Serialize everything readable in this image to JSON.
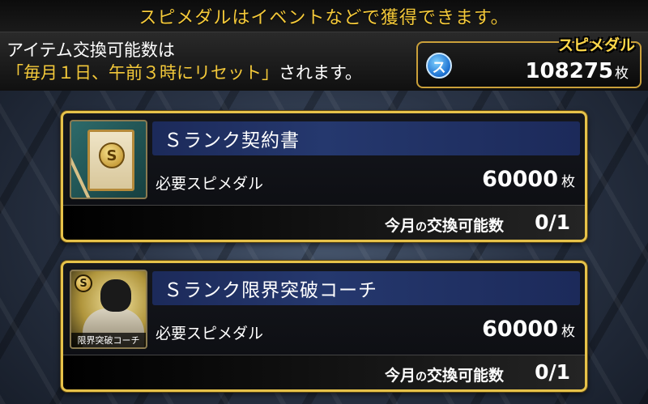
{
  "banner": {
    "text": "スピメダルはイベントなどで獲得できます。"
  },
  "info": {
    "line1": "アイテム交換可能数は",
    "line2_highlight": "「毎月１日、午前３時にリセット」",
    "line2_rest": "されます。"
  },
  "currency": {
    "label": "スピメダル",
    "icon_glyph": "ス",
    "icon": "medal-coin-icon",
    "amount": "108275",
    "unit": "枚"
  },
  "items": [
    {
      "name": "Ｓランク契約書",
      "cost_label": "必要スピメダル",
      "cost": "60000",
      "cost_unit": "枚",
      "limit_label_prefix": "今月",
      "limit_label_particle": "の",
      "limit_label_suffix": "交換可能数",
      "limit_value": "0/1",
      "icon": "contract-scroll-icon",
      "seal_glyph": "S"
    },
    {
      "name": "Ｓランク限界突破コーチ",
      "cost_label": "必要スピメダル",
      "cost": "60000",
      "cost_unit": "枚",
      "limit_label_prefix": "今月",
      "limit_label_particle": "の",
      "limit_label_suffix": "交換可能数",
      "limit_value": "0/1",
      "icon": "coach-portrait-icon",
      "badge_glyph": "S",
      "thumb_caption": "限界突破コーチ"
    }
  ],
  "colors": {
    "gold": "#e6c24a",
    "highlight_text": "#f4c93a",
    "title_bar": "#25386e"
  }
}
